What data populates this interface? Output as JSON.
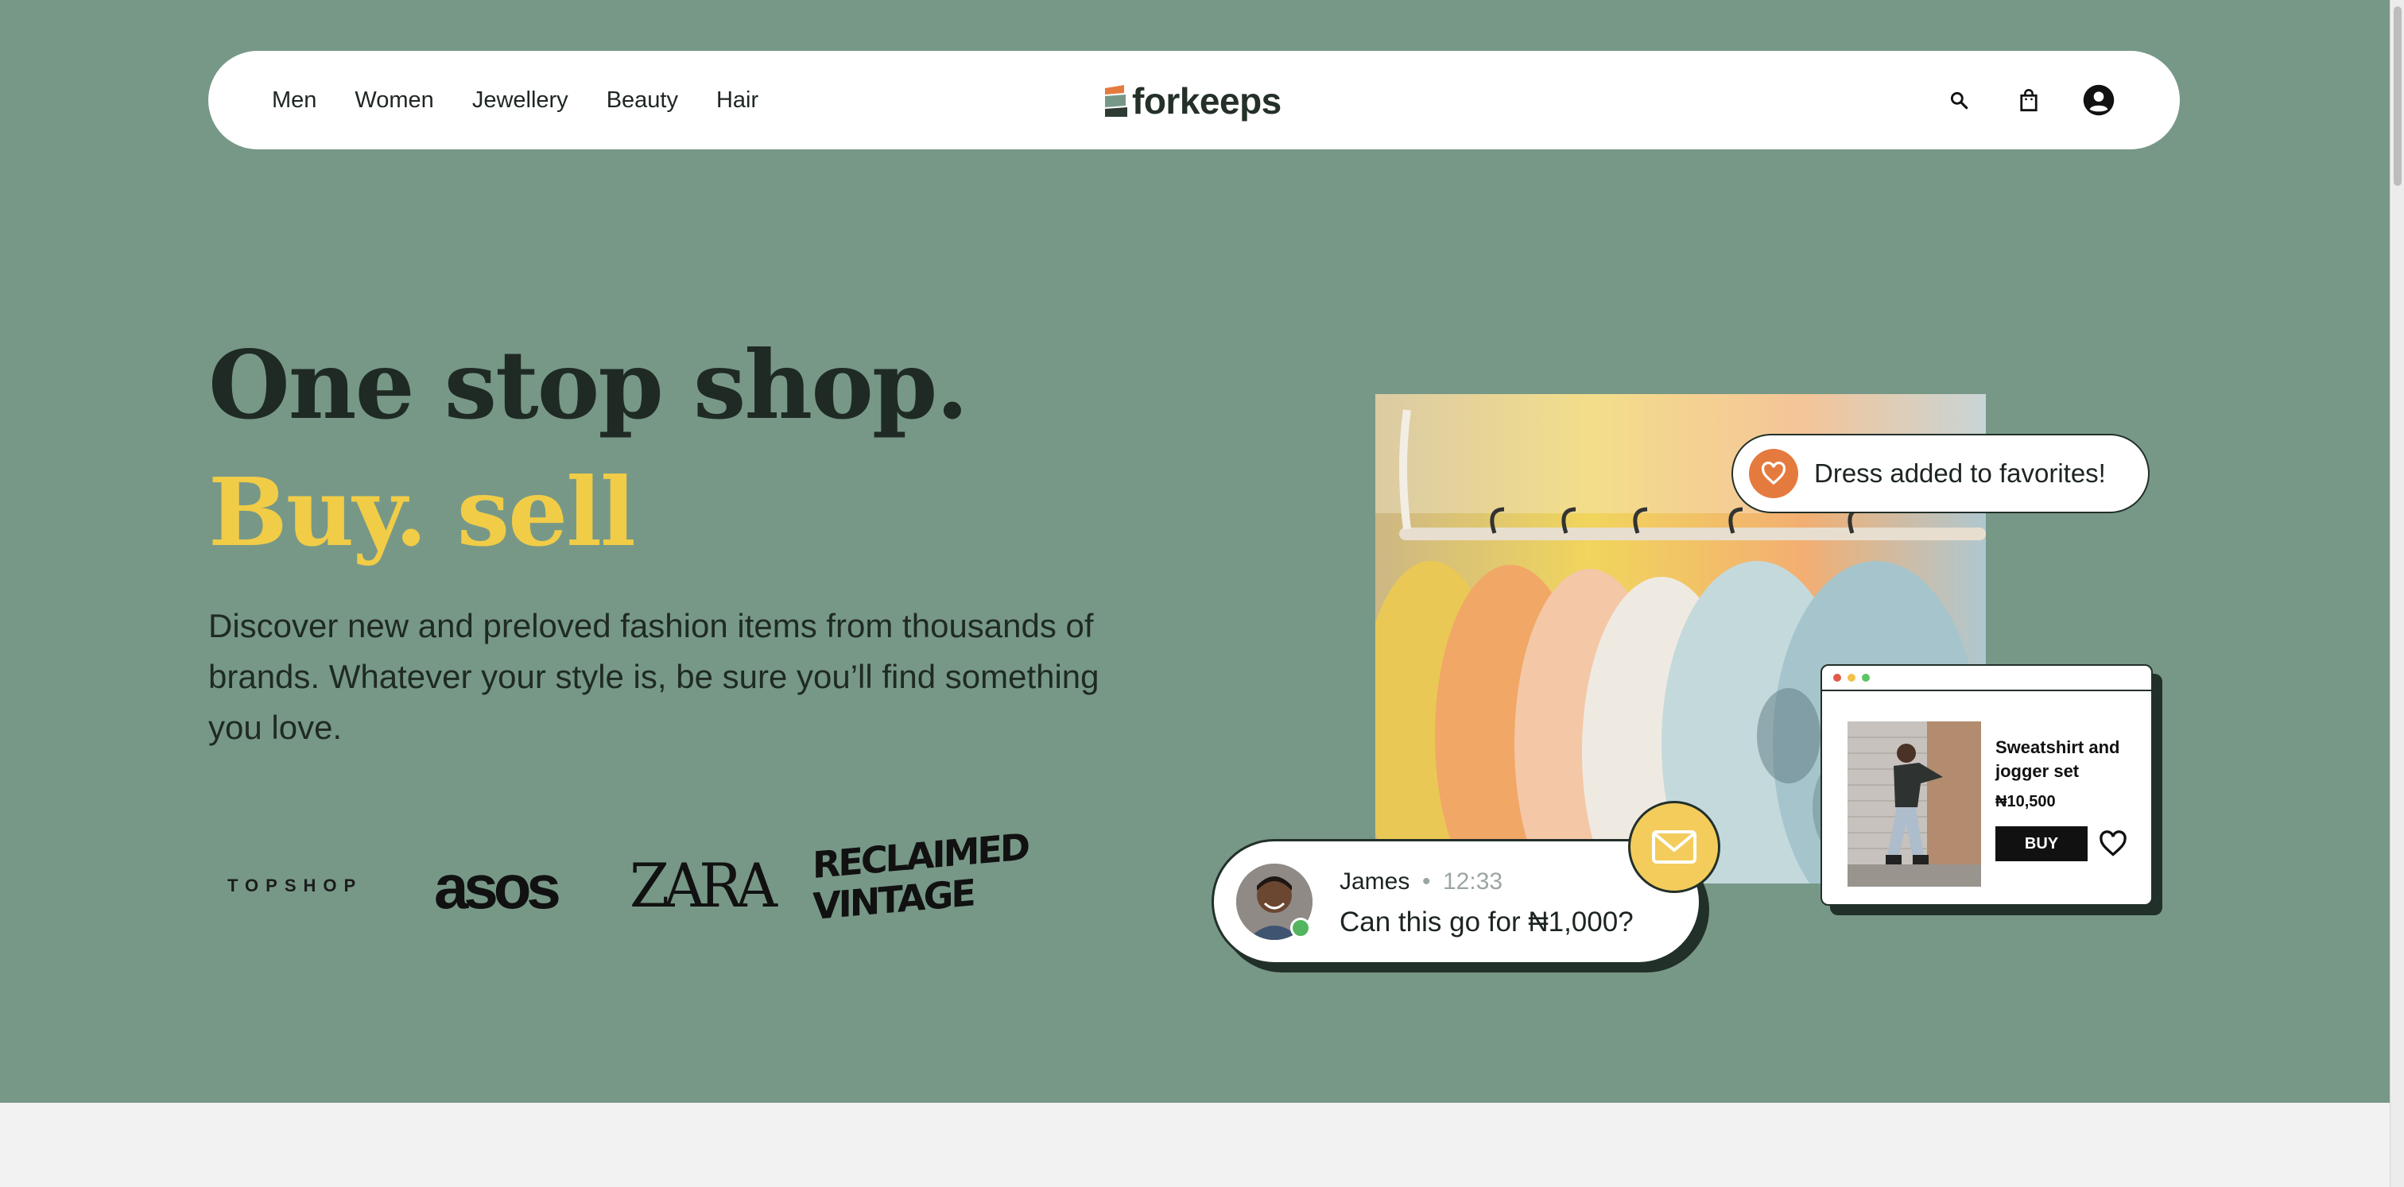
{
  "nav": {
    "links": [
      "Men",
      "Women",
      "Jewellery",
      "Beauty",
      "Hair"
    ],
    "logo_text": "forkeeps",
    "icons": [
      "search-icon",
      "shopping-bag-icon",
      "account-icon"
    ]
  },
  "hero": {
    "headline_line1": "One stop shop.",
    "headline_line2": "Buy. sell",
    "description": "Discover new and preloved fashion items from thousands of brands. Whatever your style is, be sure you’ll find something you love."
  },
  "brands": {
    "topshop": "TOPSHOP",
    "asos": "asos",
    "zara": "ZARA",
    "reclaimed_vintage": "RECLAIMED VINTAGE"
  },
  "favorite_toast": {
    "text": "Dress added to favorites!",
    "icon": "heart-icon"
  },
  "product_card": {
    "title": "Sweatshirt and jogger set",
    "price": "₦10,500",
    "buy_label": "BUY"
  },
  "chat": {
    "name": "James",
    "time": "12:33",
    "message": "Can this go for ₦1,000?",
    "status": "online"
  },
  "colors": {
    "hero_bg": "#779887",
    "accent_yellow": "#f1cc47",
    "heart_orange": "#e57a3f",
    "dark": "#1f2a24"
  }
}
